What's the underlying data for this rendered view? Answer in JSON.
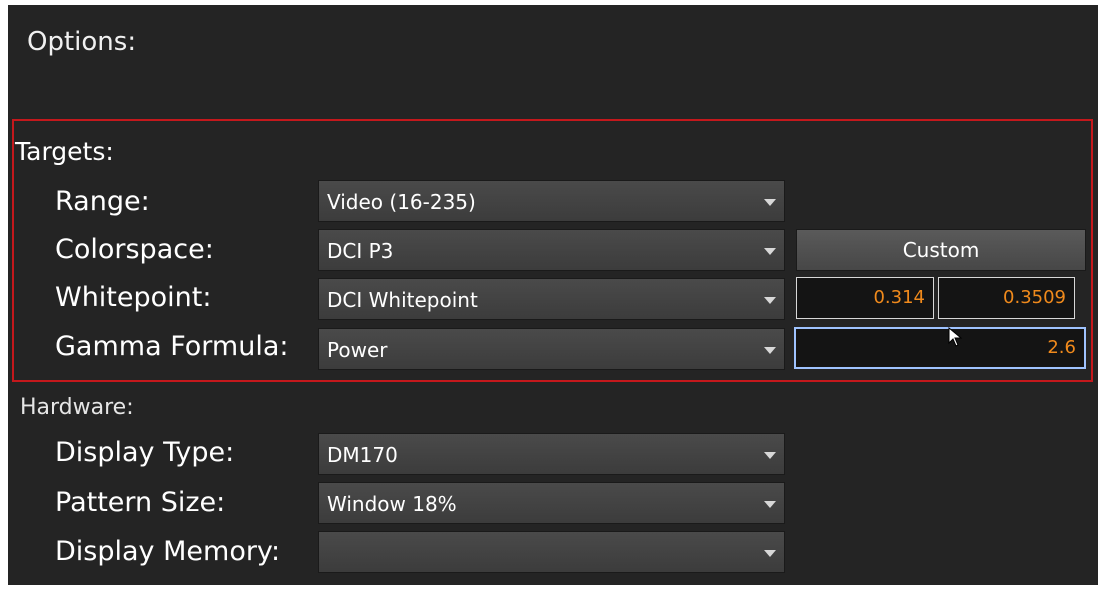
{
  "header": {
    "title": "Options:"
  },
  "targets": {
    "section_label": "Targets:",
    "range": {
      "label": "Range:",
      "value": "Video (16-235)"
    },
    "colorspace": {
      "label": "Colorspace:",
      "value": "DCI P3",
      "custom_button": "Custom"
    },
    "whitepoint": {
      "label": "Whitepoint:",
      "value": "DCI Whitepoint",
      "x": "0.314",
      "y": "0.3509"
    },
    "gamma": {
      "label": "Gamma Formula:",
      "value": "Power",
      "amount": "2.6"
    }
  },
  "hardware": {
    "section_label": "Hardware:",
    "display_type": {
      "label": "Display Type:",
      "value": "DM170"
    },
    "pattern_size": {
      "label": "Pattern Size:",
      "value": "Window 18%"
    },
    "display_memory": {
      "label": "Display Memory:",
      "value": ""
    }
  },
  "colors": {
    "background": "#242424",
    "highlight_border": "#c4181c",
    "numeric_text": "#f08a1c",
    "focus_border": "#9fc3ff"
  },
  "icons": {
    "dropdown": "chevron-down-icon",
    "cursor": "mouse-pointer-icon"
  }
}
